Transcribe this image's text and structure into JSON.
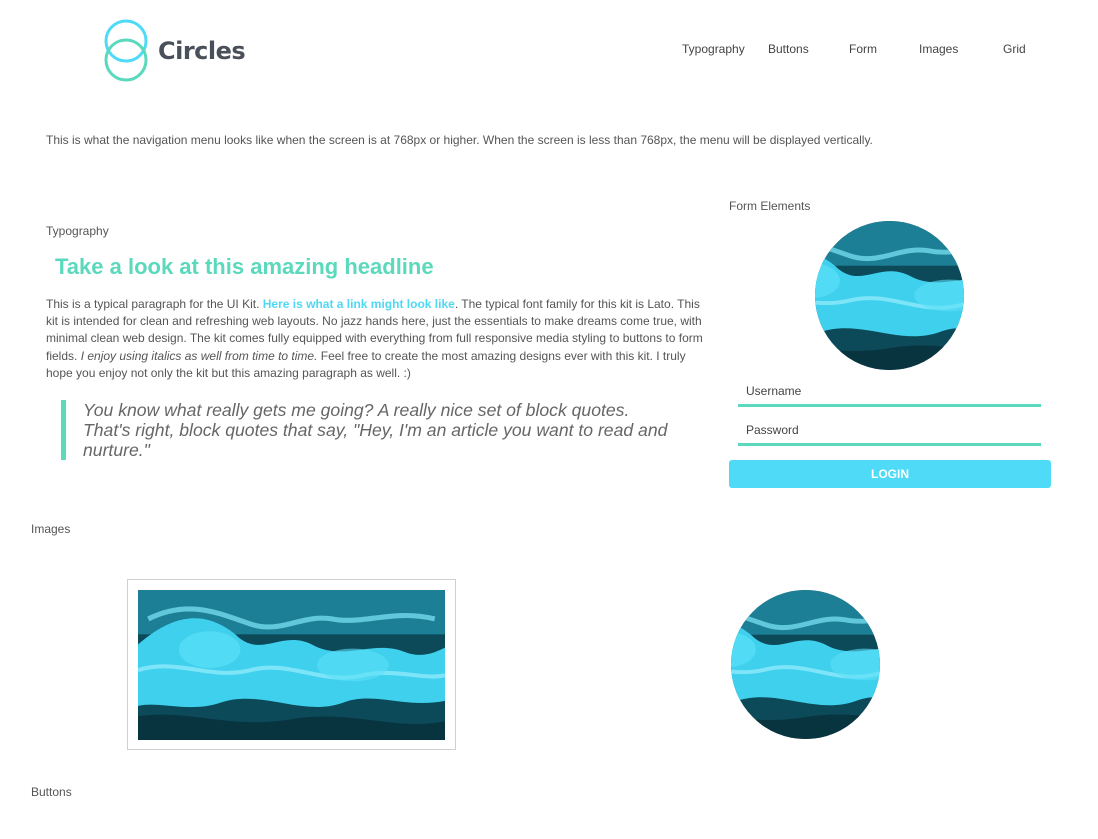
{
  "brand": {
    "name": "Circles"
  },
  "nav": {
    "items": [
      "Typography",
      "Buttons",
      "Form",
      "Images",
      "Grid"
    ]
  },
  "intro_text": "This is what the navigation menu looks like when the screen is at 768px or higher. When the screen is less than 768px, the menu will be displayed vertically.",
  "typography": {
    "section_label": "Typography",
    "headline": "Take a look at this amazing headline",
    "paragraph_start": "This is a typical paragraph for the UI Kit. ",
    "link_text": "Here is what a link might look like",
    "paragraph_middle": ". The typical font family for this kit is Lato. This kit is intended for clean and refreshing web layouts. No jazz hands here, just the essentials to make dreams come true, with minimal clean web design. The kit comes fully equipped with everything from full responsive media styling to buttons to form fields. ",
    "italic_text": "I enjoy using italics as well from time to time.",
    "paragraph_end": " Feel free to create the most amazing designs ever with this kit. I truly hope you enjoy not only the kit but this amazing paragraph as well. :)",
    "blockquote": "You know what really gets me going? A really nice set of block quotes. That's right, block quotes that say, \"Hey, I'm an article you want to read and nurture.\""
  },
  "form": {
    "section_label": "Form Elements",
    "username_placeholder": "Username",
    "password_placeholder": "Password",
    "login_label": "LOGIN"
  },
  "images": {
    "section_label": "Images"
  },
  "buttons": {
    "section_label": "Buttons"
  },
  "colors": {
    "accent_green": "#5bd9bd",
    "accent_blue": "#4fdaf8",
    "text": "#555555"
  }
}
